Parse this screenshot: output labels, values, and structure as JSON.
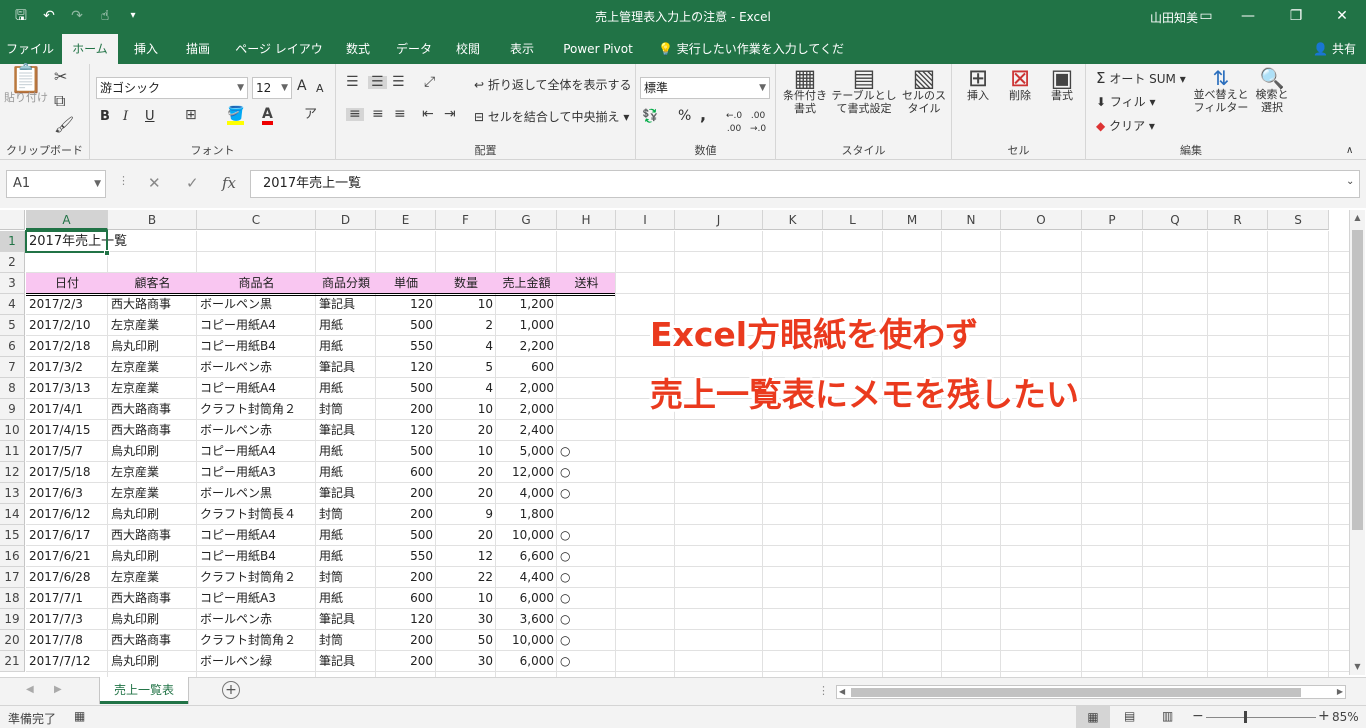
{
  "window": {
    "title": "売上管理表入力上の注意 - Excel",
    "user": "山田知美"
  },
  "tabs": [
    "ファイル",
    "ホーム",
    "挿入",
    "描画",
    "ページ レイアウト",
    "数式",
    "データ",
    "校閲",
    "表示",
    "Power Pivot",
    "実行したい作業を入力してください"
  ],
  "share": "共有",
  "ribbon": {
    "clipboard": {
      "paste": "貼り付け",
      "label": "クリップボード"
    },
    "font": {
      "name": "游ゴシック",
      "size": "12",
      "label": "フォント",
      "bold": "B",
      "italic": "I",
      "underline": "U",
      "grow": "A",
      "shrink": "A"
    },
    "align": {
      "wrap": "折り返して全体を表示する",
      "merge": "セルを結合して中央揃え",
      "label": "配置"
    },
    "number": {
      "format": "標準",
      "label": "数値",
      "percent": "%",
      "comma": ","
    },
    "style": {
      "cond": "条件付き書式",
      "table": "テーブルとして書式設定",
      "cell": "セルのスタイル",
      "label": "スタイル"
    },
    "cells": {
      "insert": "挿入",
      "delete": "削除",
      "format": "書式",
      "label": "セル"
    },
    "edit": {
      "autosum": "オート SUM",
      "fill": "フィル",
      "clear": "クリア",
      "sort": "並べ替えとフィルター",
      "find": "検索と選択",
      "label": "編集"
    }
  },
  "formula": {
    "namebox": "A1",
    "value": "2017年売上一覧"
  },
  "columns": [
    "A",
    "B",
    "C",
    "D",
    "E",
    "F",
    "G",
    "H",
    "I",
    "J",
    "K",
    "L",
    "M",
    "N",
    "O",
    "P",
    "Q",
    "R",
    "S"
  ],
  "rows": [
    "1",
    "2",
    "3",
    "4",
    "5",
    "6",
    "7",
    "8",
    "9",
    "10",
    "11",
    "12",
    "13",
    "14",
    "15",
    "16",
    "17",
    "18",
    "19",
    "20",
    "21"
  ],
  "sheet": {
    "title": "2017年売上一覧",
    "headers": [
      "日付",
      "顧客名",
      "商品名",
      "商品分類",
      "単価",
      "数量",
      "売上金額",
      "送料"
    ],
    "data": [
      [
        "2017/2/3",
        "西大路商事",
        "ボールペン黒",
        "筆記具",
        "120",
        "10",
        "1,200",
        ""
      ],
      [
        "2017/2/10",
        "左京産業",
        "コピー用紙A4",
        "用紙",
        "500",
        "2",
        "1,000",
        ""
      ],
      [
        "2017/2/18",
        "烏丸印刷",
        "コピー用紙B4",
        "用紙",
        "550",
        "4",
        "2,200",
        ""
      ],
      [
        "2017/3/2",
        "左京産業",
        "ボールペン赤",
        "筆記具",
        "120",
        "5",
        "600",
        ""
      ],
      [
        "2017/3/13",
        "左京産業",
        "コピー用紙A4",
        "用紙",
        "500",
        "4",
        "2,000",
        ""
      ],
      [
        "2017/4/1",
        "西大路商事",
        "クラフト封筒角２",
        "封筒",
        "200",
        "10",
        "2,000",
        ""
      ],
      [
        "2017/4/15",
        "西大路商事",
        "ボールペン赤",
        "筆記具",
        "120",
        "20",
        "2,400",
        ""
      ],
      [
        "2017/5/7",
        "烏丸印刷",
        "コピー用紙A4",
        "用紙",
        "500",
        "10",
        "5,000",
        "○"
      ],
      [
        "2017/5/18",
        "左京産業",
        "コピー用紙A3",
        "用紙",
        "600",
        "20",
        "12,000",
        "○"
      ],
      [
        "2017/6/3",
        "左京産業",
        "ボールペン黒",
        "筆記具",
        "200",
        "20",
        "4,000",
        "○"
      ],
      [
        "2017/6/12",
        "烏丸印刷",
        "クラフト封筒長４",
        "封筒",
        "200",
        "9",
        "1,800",
        ""
      ],
      [
        "2017/6/17",
        "西大路商事",
        "コピー用紙A4",
        "用紙",
        "500",
        "20",
        "10,000",
        "○"
      ],
      [
        "2017/6/21",
        "烏丸印刷",
        "コピー用紙B4",
        "用紙",
        "550",
        "12",
        "6,600",
        "○"
      ],
      [
        "2017/6/28",
        "左京産業",
        "クラフト封筒角２",
        "封筒",
        "200",
        "22",
        "4,400",
        "○"
      ],
      [
        "2017/7/1",
        "西大路商事",
        "コピー用紙A3",
        "用紙",
        "600",
        "10",
        "6,000",
        "○"
      ],
      [
        "2017/7/3",
        "烏丸印刷",
        "ボールペン赤",
        "筆記具",
        "120",
        "30",
        "3,600",
        "○"
      ],
      [
        "2017/7/8",
        "西大路商事",
        "クラフト封筒角２",
        "封筒",
        "200",
        "50",
        "10,000",
        "○"
      ],
      [
        "2017/7/12",
        "烏丸印刷",
        "ボールペン緑",
        "筆記具",
        "200",
        "30",
        "6,000",
        "○"
      ]
    ]
  },
  "overlay": {
    "line1": "Excel方眼紙を使わず",
    "line2": "売上一覧表にメモを残したい"
  },
  "sheettab": "売上一覧表",
  "status": {
    "ready": "準備完了",
    "zoom": "85%"
  },
  "colors": {
    "excel_green": "#217346",
    "header_band": "#f9c6f1",
    "overlay_text": "#ea3a1e"
  }
}
